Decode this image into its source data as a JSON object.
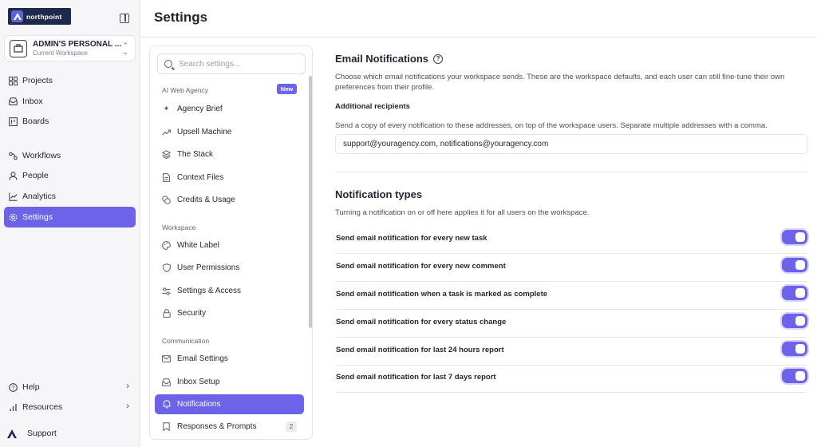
{
  "app": {
    "logo_text": "northpoint"
  },
  "workspace": {
    "name": "ADMIN'S PERSONAL ...",
    "sub": "Current Workspace"
  },
  "nav": [
    {
      "label": "Projects",
      "icon": "grid-icon"
    },
    {
      "label": "Inbox",
      "icon": "inbox-icon"
    },
    {
      "label": "Boards",
      "icon": "board-icon"
    },
    {
      "label": "Workflows",
      "icon": "workflow-icon"
    },
    {
      "label": "People",
      "icon": "person-icon"
    },
    {
      "label": "Analytics",
      "icon": "chart-icon"
    },
    {
      "label": "Settings",
      "icon": "gear-icon",
      "active": true
    }
  ],
  "bottom_nav": [
    {
      "label": "Help",
      "icon": "help-icon"
    },
    {
      "label": "Resources",
      "icon": "bar-chart-icon"
    }
  ],
  "support": {
    "label": "Support"
  },
  "page": {
    "title": "Settings"
  },
  "search": {
    "placeholder": "Search settings..."
  },
  "settings_nav": {
    "groups": [
      {
        "label": "AI Web Agency",
        "badge": "New",
        "items": [
          {
            "label": "Agency Brief",
            "icon": "sparkle-icon"
          },
          {
            "label": "Upsell Machine",
            "icon": "trend-up-icon"
          },
          {
            "label": "The Stack",
            "icon": "layers-icon"
          },
          {
            "label": "Context Files",
            "icon": "file-icon"
          },
          {
            "label": "Credits & Usage",
            "icon": "coins-icon"
          }
        ]
      },
      {
        "label": "Workspace",
        "items": [
          {
            "label": "White Label",
            "icon": "palette-icon"
          },
          {
            "label": "User Permissions",
            "icon": "shield-icon"
          },
          {
            "label": "Settings & Access",
            "icon": "sliders-icon"
          },
          {
            "label": "Security",
            "icon": "lock-icon"
          }
        ]
      },
      {
        "label": "Communication",
        "items": [
          {
            "label": "Email Settings",
            "icon": "mail-icon"
          },
          {
            "label": "Inbox Setup",
            "icon": "inbox-icon"
          },
          {
            "label": "Notifications",
            "icon": "bell-icon",
            "active": true
          },
          {
            "label": "Responses & Prompts",
            "icon": "bookmark-icon",
            "count": "2"
          }
        ]
      }
    ]
  },
  "email_notifications": {
    "title": "Email Notifications",
    "description_line1": "Choose which email notifications your workspace sends. These are the workspace defaults, and each user can still fine-tune their own",
    "description_line2": "preferences from their profile.",
    "recipients_label": "Additional recipients",
    "recipients_help": "Send a copy of every notification to these addresses, on top of the workspace users. Separate multiple addresses with a comma.",
    "recipients_value": "support@youragency.com, notifications@youragency.com"
  },
  "notification_types": {
    "title": "Notification types",
    "description": "Turning a notification on or off here applies it for all users on the workspace.",
    "items": [
      {
        "label": "Send email notification for every new task",
        "enabled": true
      },
      {
        "label": "Send email notification for every new comment",
        "enabled": true
      },
      {
        "label": "Send email notification when a task is marked as complete",
        "enabled": true
      },
      {
        "label": "Send email notification for every status change",
        "enabled": true
      },
      {
        "label": "Send email notification for last 24 hours report",
        "enabled": true
      },
      {
        "label": "Send email notification for last 7 days report",
        "enabled": true
      }
    ]
  },
  "colors": {
    "accent": "#6c63e8",
    "logo_bg": "#1e2a4a",
    "sidebar_bg": "#f6f6f8"
  }
}
